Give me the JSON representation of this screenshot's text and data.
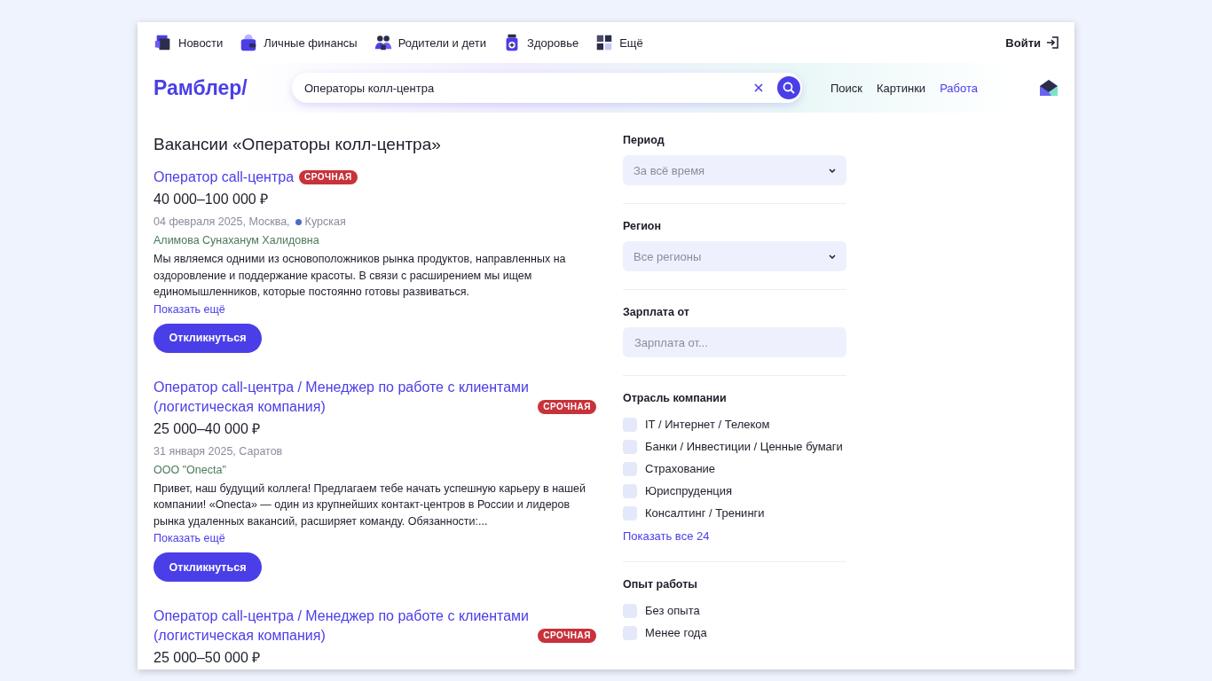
{
  "top_nav": [
    {
      "label": "Новости"
    },
    {
      "label": "Личные финансы"
    },
    {
      "label": "Родители и дети"
    },
    {
      "label": "Здоровье"
    },
    {
      "label": "Ещё"
    }
  ],
  "login": {
    "label": "Войти"
  },
  "logo": "Рамблер/",
  "search": {
    "value": "Операторы колл-центра"
  },
  "header_links": [
    {
      "label": "Поиск",
      "selected": false
    },
    {
      "label": "Картинки",
      "selected": false
    },
    {
      "label": "Работа",
      "selected": true
    }
  ],
  "page_title": "Вакансии «Операторы колл-центра»",
  "vacancies": [
    {
      "title": "Оператор call-центра",
      "badge": "СРОЧНАЯ",
      "salary": "40 000–100 000 ₽",
      "meta": "04 февраля 2025, Москва,",
      "metro": {
        "name": "Курская",
        "color": "#4e6bc9"
      },
      "company": "Алимова Сунаханум Халидовна",
      "description": "Мы являемся одними из основоположников рынка продуктов, направленных на оздоровление и поддержание красоты. В связи с расширением мы ищем единомышленников, которые постоянно готовы развиваться.",
      "more": "Показать ещё",
      "button": "Откликнуться"
    },
    {
      "title": "Оператор call-центра / Менеджер по работе с клиентами (логистическая компания)",
      "badge": "СРОЧНАЯ",
      "salary": "25 000–40 000 ₽",
      "meta": "31 января 2025, Саратов",
      "company": "ООО \"Onecta\"",
      "description": "Привет, наш будущий коллега! Предлагаем тебе начать успешную карьеру в нашей компании! «Onecta» — один из крупнейших контакт-центров в России и лидеров рынка удаленных вакансий, расширяет команду. Обязанности:...",
      "more": "Показать ещё",
      "button": "Откликнуться"
    },
    {
      "title": "Оператор call-центра / Менеджер по работе с клиентами (логистическая компания)",
      "badge": "СРОЧНАЯ",
      "salary": "25 000–50 000 ₽"
    }
  ],
  "filters": [
    {
      "kind": "select",
      "title": "Период",
      "value": "За всё время"
    },
    {
      "kind": "select",
      "title": "Регион",
      "value": "Все регионы"
    },
    {
      "kind": "input",
      "title": "Зарплата от",
      "placeholder": "Зарплата от..."
    },
    {
      "kind": "checks",
      "title": "Отрасль компании",
      "options": [
        {
          "label": "IT / Интернет / Телеком",
          "checked": false
        },
        {
          "label": "Банки / Инвестиции / Ценные бумаги",
          "checked": false
        },
        {
          "label": "Страхование",
          "checked": false
        },
        {
          "label": "Юриспруденция",
          "checked": false
        },
        {
          "label": "Консалтинг / Тренинги",
          "checked": false
        }
      ],
      "more": "Показать все 24"
    },
    {
      "kind": "checks",
      "title": "Опыт работы",
      "options": [
        {
          "label": "Без опыта",
          "checked": false
        },
        {
          "label": "Менее года",
          "checked": false
        }
      ]
    }
  ]
}
